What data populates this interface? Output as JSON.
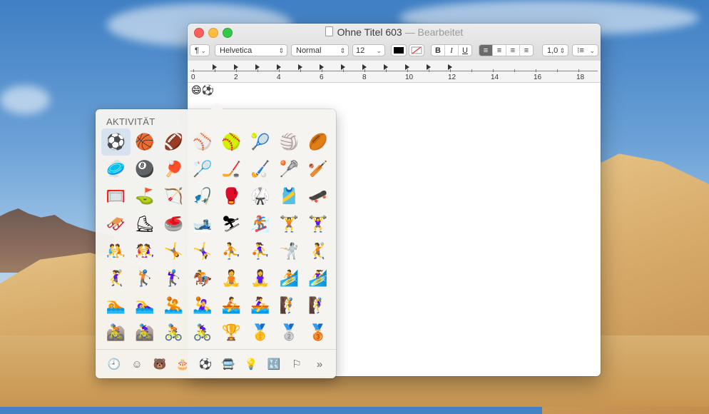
{
  "window": {
    "title": "Ohne Titel 603",
    "edited": "— Bearbeitet"
  },
  "toolbar": {
    "paragraph_style": "¶",
    "font_family": "Helvetica",
    "font_style": "Normal",
    "font_size": "12",
    "bold": "B",
    "italic": "I",
    "underline": "U",
    "line_spacing": "1,0",
    "list_icon": "⁝≡"
  },
  "ruler": {
    "numbers": [
      "0",
      "2",
      "4",
      "6",
      "8",
      "10",
      "12",
      "14",
      "16",
      "18"
    ]
  },
  "document": {
    "text": "😄⚽"
  },
  "palette": {
    "title": "AKTIVITÄT",
    "emojis": [
      "⚽",
      "🏀",
      "🏈",
      "⚾",
      "🥎",
      "🎾",
      "🏐",
      "🏉",
      "🥏",
      "🎱",
      "🏓",
      "🏸",
      "🏒",
      "🏑",
      "🥍",
      "🏏",
      "🥅",
      "⛳",
      "🏹",
      "🎣",
      "🥊",
      "🥋",
      "🎽",
      "🛹",
      "🛷",
      "⛸",
      "🥌",
      "🎿",
      "⛷",
      "🏂",
      "🏋️",
      "🏋️‍♀️",
      "🤼",
      "🤼‍♀️",
      "🤸",
      "🤸‍♀️",
      "⛹️",
      "⛹️‍♀️",
      "🤺",
      "🤾",
      "🤾‍♀️",
      "🏌️",
      "🏌️‍♀️",
      "🏇",
      "🧘",
      "🧘‍♀️",
      "🏄",
      "🏄‍♀️",
      "🏊",
      "🏊‍♀️",
      "🤽",
      "🤽‍♀️",
      "🚣",
      "🚣‍♀️",
      "🧗",
      "🧗‍♀️",
      "🚵",
      "🚵‍♀️",
      "🚴",
      "🚴‍♀️",
      "🏆",
      "🥇",
      "🥈",
      "🥉"
    ],
    "categories": [
      {
        "name": "recent-icon",
        "glyph": "🕘"
      },
      {
        "name": "smileys-icon",
        "glyph": "☺"
      },
      {
        "name": "animals-icon",
        "glyph": "🐻"
      },
      {
        "name": "food-icon",
        "glyph": "🎂"
      },
      {
        "name": "activity-icon",
        "glyph": "⚽"
      },
      {
        "name": "travel-icon",
        "glyph": "🚍"
      },
      {
        "name": "objects-icon",
        "glyph": "💡"
      },
      {
        "name": "symbols-icon",
        "glyph": "🔣"
      },
      {
        "name": "flags-icon",
        "glyph": "⚐"
      },
      {
        "name": "more-icon",
        "glyph": "»"
      }
    ]
  },
  "colors": {
    "accent": "#1a6fe8",
    "close": "#fc605b",
    "minimize": "#fdbc40",
    "maximize": "#34c84a"
  }
}
